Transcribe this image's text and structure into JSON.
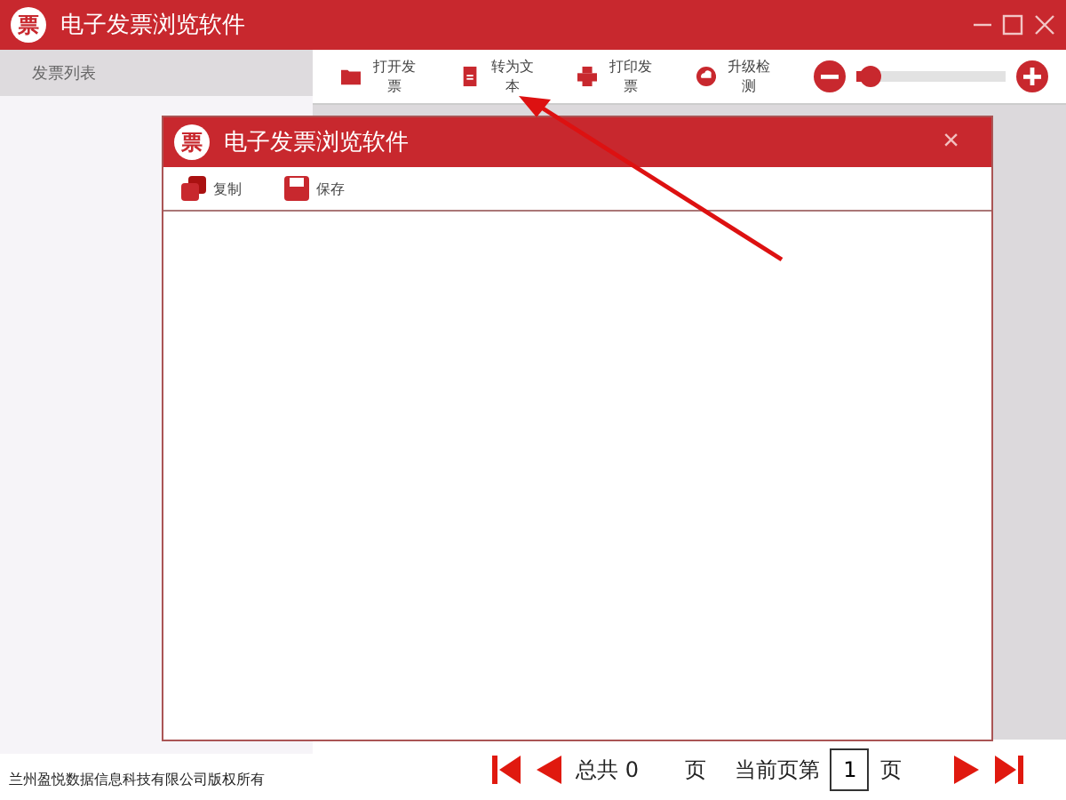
{
  "window": {
    "logo": "票",
    "title": "电子发票浏览软件"
  },
  "sidebar": {
    "header": "发票列表",
    "footer": "兰州盈悦数据信息科技有限公司版权所有"
  },
  "toolbar": [
    {
      "kind": "folder",
      "label": "打开发票"
    },
    {
      "kind": "doc",
      "label": "转为文本"
    },
    {
      "kind": "print",
      "label": "打印发票"
    },
    {
      "kind": "upgrade",
      "label": "升级检测"
    }
  ],
  "zoom": {
    "level": 0.1
  },
  "dialog": {
    "logo": "票",
    "title": "电子发票浏览软件",
    "close": "×",
    "toolbar": [
      {
        "kind": "copy",
        "label": "复制"
      },
      {
        "kind": "save",
        "label": "保存"
      }
    ]
  },
  "pager": {
    "total_label": "总共 0",
    "page_unit": "页",
    "current_label": "当前页第",
    "current": "1",
    "current_unit": "页"
  }
}
